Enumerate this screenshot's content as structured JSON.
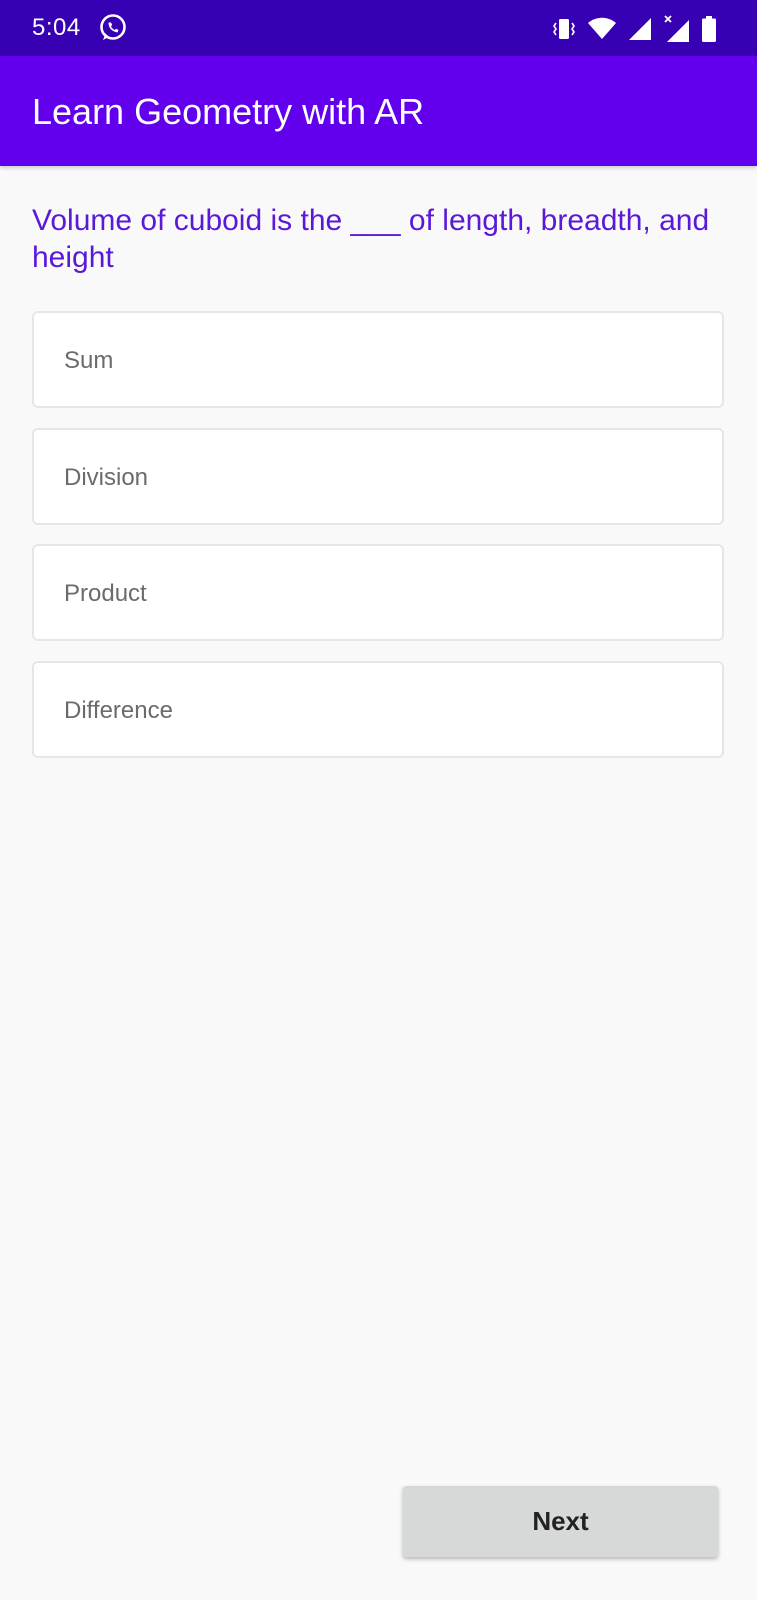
{
  "status_bar": {
    "time": "5:04",
    "background": "#3700b3",
    "icons": [
      "whatsapp-icon",
      "vibrate-icon",
      "wifi-icon",
      "signal-icon",
      "signal-no-data-icon",
      "battery-icon"
    ]
  },
  "app_bar": {
    "title": "Learn Geometry with AR",
    "background": "#6200ee"
  },
  "quiz": {
    "question": "Volume of cuboid is the ___ of length, breadth, and height",
    "question_color": "#5a18d8",
    "options": [
      {
        "label": "Sum"
      },
      {
        "label": "Division"
      },
      {
        "label": "Product"
      },
      {
        "label": "Difference"
      }
    ]
  },
  "footer": {
    "next_label": "Next"
  }
}
